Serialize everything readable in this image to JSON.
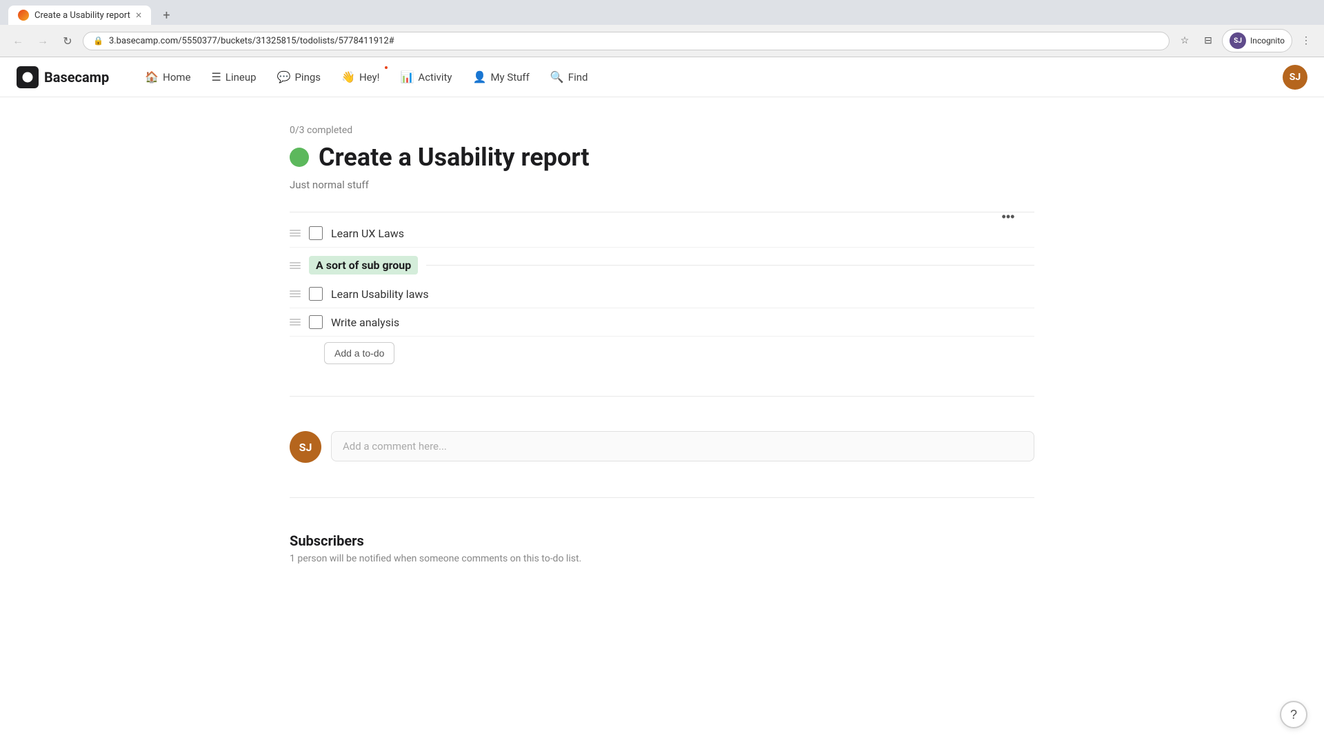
{
  "browser": {
    "tab_title": "Create a Usability report",
    "tab_close": "×",
    "tab_new": "+",
    "address": "3.basecamp.com/5550377/buckets/31325815/todolists/5778411912#",
    "incognito_label": "Incognito",
    "incognito_initials": "SJ"
  },
  "nav": {
    "logo_text": "Basecamp",
    "items": [
      {
        "id": "home",
        "label": "Home",
        "icon": "🏠"
      },
      {
        "id": "lineup",
        "label": "Lineup",
        "icon": "☰"
      },
      {
        "id": "pings",
        "label": "Pings",
        "icon": "💬"
      },
      {
        "id": "hey",
        "label": "Hey!",
        "icon": "👋"
      },
      {
        "id": "activity",
        "label": "Activity",
        "icon": "📊"
      },
      {
        "id": "mystuff",
        "label": "My Stuff",
        "icon": "👤"
      },
      {
        "id": "find",
        "label": "Find",
        "icon": "🔍"
      }
    ],
    "user_initials": "SJ"
  },
  "page": {
    "progress": "0/3 completed",
    "title": "Create a Usability report",
    "subtitle": "Just normal stuff",
    "more_options_label": "•••"
  },
  "todos": [
    {
      "id": "todo1",
      "label": "Learn UX Laws",
      "checked": false
    },
    {
      "subgroup": "A sort of sub group"
    },
    {
      "id": "todo2",
      "label": "Learn Usability laws",
      "checked": false
    },
    {
      "id": "todo3",
      "label": "Write analysis",
      "checked": false
    }
  ],
  "add_todo_label": "Add a to-do",
  "comment": {
    "user_initials": "SJ",
    "placeholder": "Add a comment here..."
  },
  "subscribers": {
    "title": "Subscribers",
    "subtitle": "1 person will be notified when someone comments on this to-do list."
  },
  "help_icon": "?"
}
